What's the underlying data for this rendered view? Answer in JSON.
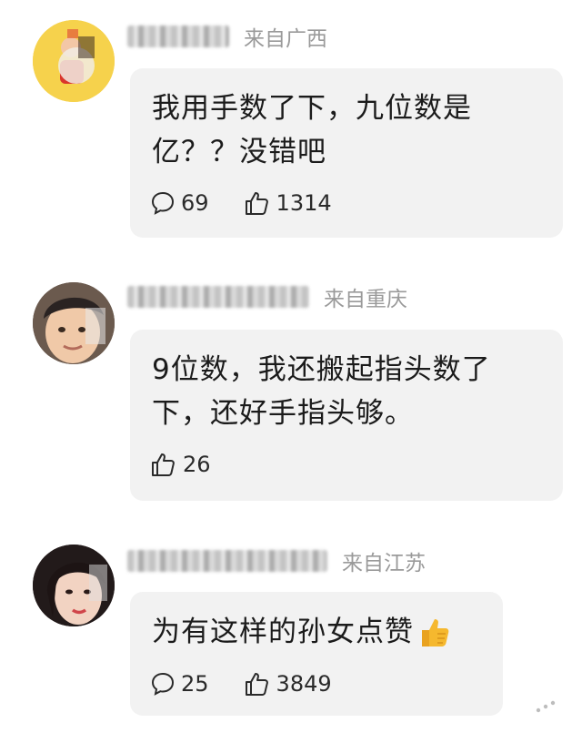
{
  "comments": [
    {
      "location": "来自广西",
      "text_lines": [
        "我用手数了下，九位数是",
        "亿？？没错吧"
      ],
      "replies": "69",
      "likes": "1314"
    },
    {
      "location": "来自重庆",
      "text_lines": [
        "9位数，我还搬起指头数了",
        "下，还好手指头够。"
      ],
      "likes": "26"
    },
    {
      "location": "来自江苏",
      "text_lines": [
        "为有这样的孙女点赞"
      ],
      "replies": "25",
      "likes": "3849"
    }
  ],
  "icons": {
    "reply": "speech-bubble-icon",
    "like": "thumbs-up-icon",
    "emoji": "thumbs-up-emoji",
    "corner": "more-dots-icon"
  },
  "colors": {
    "bubble": "#f2f2f2",
    "location": "#9a9a9a",
    "emoji": "#f5b82e"
  }
}
